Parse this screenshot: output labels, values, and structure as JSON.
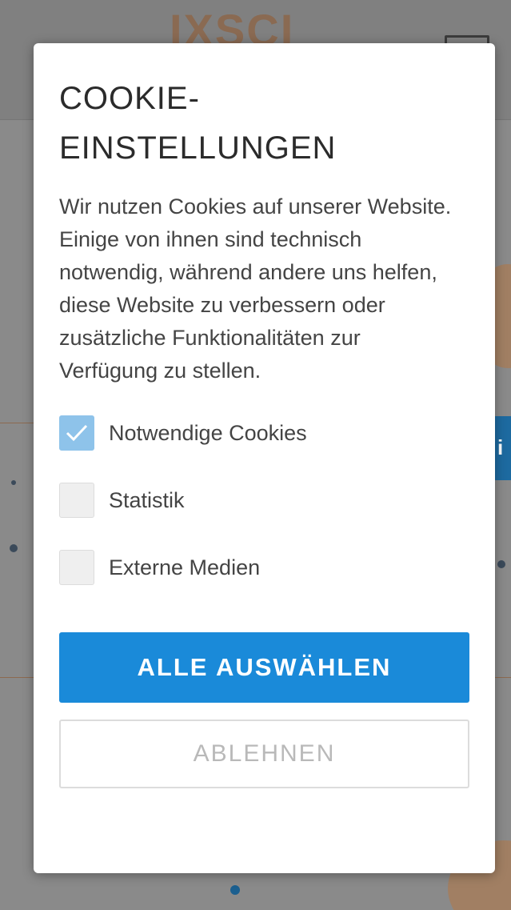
{
  "background": {
    "logo_text": "IXSCI",
    "info_tab_icon": "i"
  },
  "cookie_dialog": {
    "title": "COOKIE-EINSTELLUNGEN",
    "description": "Wir nutzen Cookies auf unserer Website. Einige von ihnen sind technisch notwendig, während andere uns helfen, diese Website zu verbessern oder zusätzliche Funktionalitäten zur Verfügung zu stellen.",
    "options": [
      {
        "label": "Notwendige Cookies",
        "checked": true
      },
      {
        "label": "Statistik",
        "checked": false
      },
      {
        "label": "Externe Medien",
        "checked": false
      }
    ],
    "accept_all_label": "ALLE AUSWÄHLEN",
    "decline_label": "ABLEHNEN"
  },
  "colors": {
    "primary": "#1a8ad9",
    "checkbox_checked": "#8ec3ea",
    "overlay": "#808080"
  }
}
